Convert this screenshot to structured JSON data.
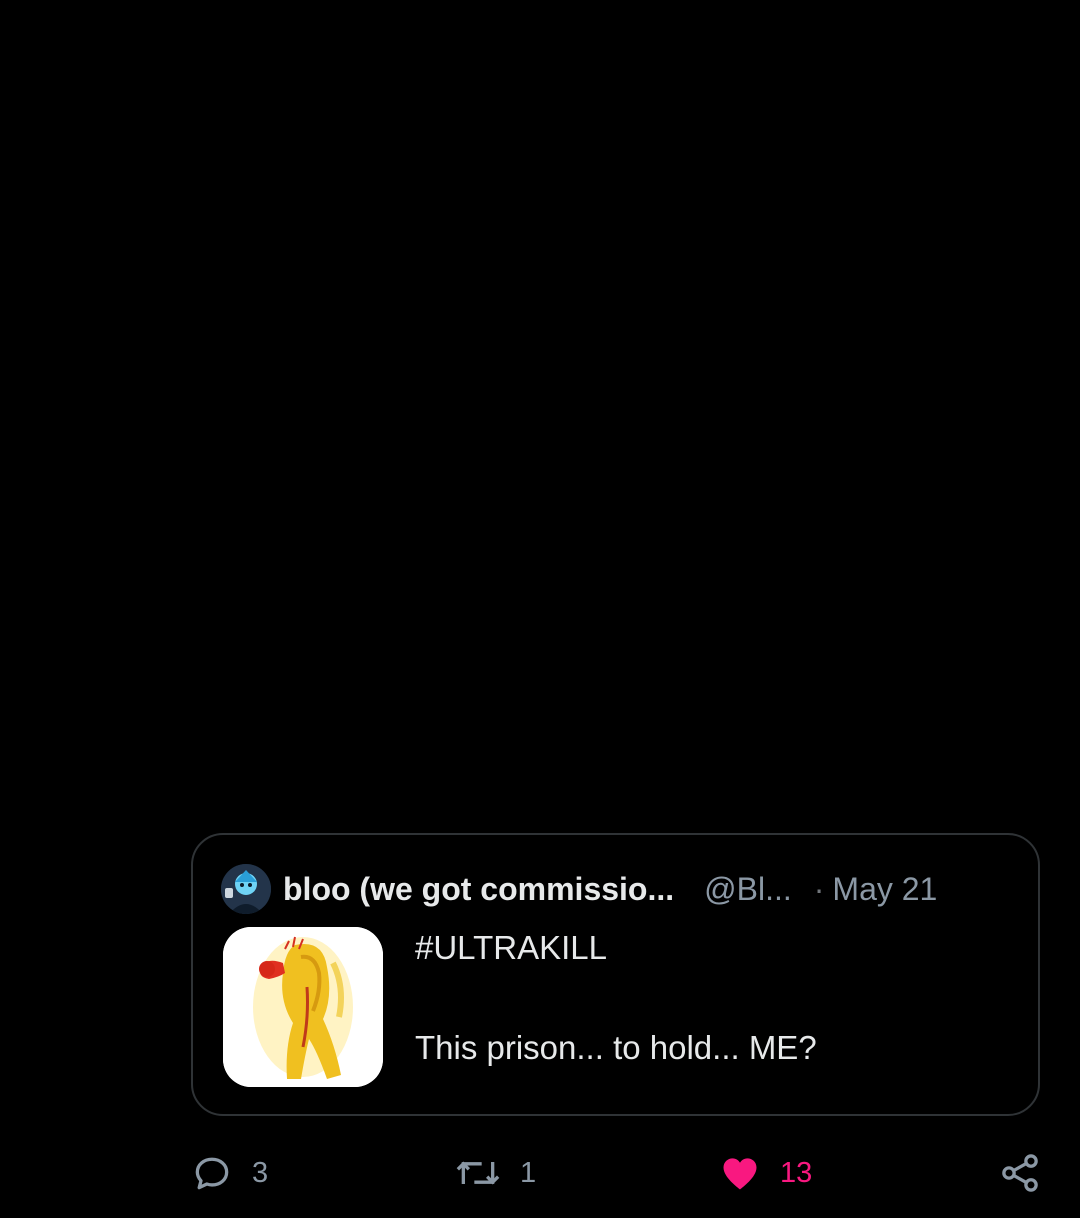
{
  "quoted_post": {
    "display_name": "bloo (we got commissio...",
    "handle": "@Bl...",
    "separator": "·",
    "date": "May 21",
    "text_line_1": "#ULTRAKILL",
    "text_line_2": "This prison... to hold... ME?",
    "avatar_icon": "user-avatar-icon",
    "thumbnail_icon": "image-thumbnail"
  },
  "actions": {
    "replies": "3",
    "reposts": "1",
    "likes": "13",
    "liked": true,
    "icons": {
      "reply": "reply-bubble-icon",
      "repost": "repost-arrows-icon",
      "like": "heart-icon",
      "share": "share-icon"
    }
  },
  "colors": {
    "background": "#000000",
    "text": "#e7e9ea",
    "muted": "#8b98a5",
    "like_pink": "#f91880",
    "border": "#2f3336"
  }
}
